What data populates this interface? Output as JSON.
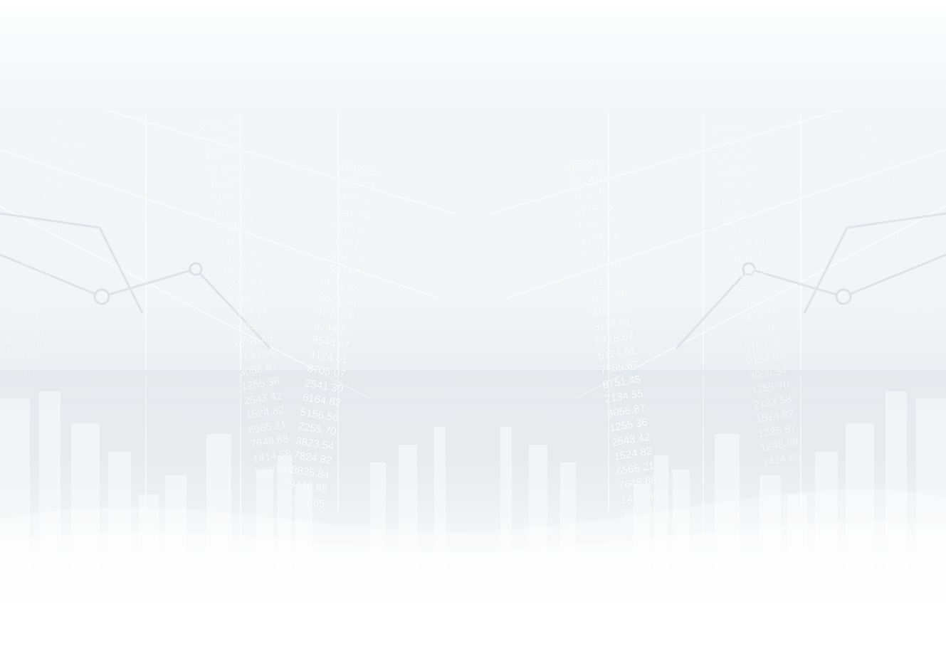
{
  "background": {
    "colors": {
      "top": "#ffffff",
      "mid": "#f2f4f6",
      "band": "#e9ecef",
      "bottom": "#ffffff",
      "numbers": "#ffffff"
    },
    "number_columns": [
      [
        "1522.52",
        "2154.54",
        "1552.22",
        "6364.13",
        "2254.41",
        "3124.87",
        "6128.87",
        "4141.46",
        "2121.35",
        "3123.43",
        "2218.87",
        "4152.29",
        "7824.61",
        "5124.87",
        "2134.87",
        "3056.58",
        "1524.82",
        "5405.87"
      ],
      [
        "8754.13",
        "1514.25",
        "1417.52",
        "3215.25",
        "1552.52",
        "5184.13",
        "8704.22",
        "5128.67",
        "7114.87",
        "9721.88",
        "5124.76",
        "3115.51",
        "8715.67",
        "5124.61",
        "7605.67",
        "8751.45",
        "2134.55",
        "3056.87",
        "1255.36",
        "2543.42",
        "1524.82",
        "6565.21",
        "7648.88",
        "1414.58",
        "5130.52"
      ],
      [
        "2543.15",
        "1561.21",
        "2427.52",
        "7545.24",
        "6542.52",
        "2124.13",
        "3684.21",
        "7524.67",
        "6824.87",
        "9621.46",
        "5724.76",
        "8744.82",
        "9548.87",
        "4124.61",
        "8705.07",
        "2541.30",
        "6164.82",
        "5156.56",
        "2255.70",
        "3823.54",
        "7824.82",
        "8835.84",
        "9446.88",
        "2864.65"
      ],
      [
        "8754.15",
        "1714.25",
        "1417.52",
        "3215.25",
        "1552.52",
        "5184.13",
        "8724.22",
        "5124.67",
        "7114.87",
        "9721.88",
        "3124.76",
        "3114.61",
        "8718.67",
        "5124.61",
        "7605.67",
        "8751.45",
        "2134.55",
        "3056.87",
        "1255.36",
        "2543.42",
        "1524.82",
        "6565.21",
        "7648.88",
        "1414.88",
        "2813.88"
      ],
      [
        "1233.15",
        "1564.24",
        "1527.57",
        "4215.24",
        "1552.52",
        "6784.13",
        "8754.21",
        "5124.67",
        "8724.87",
        "3121.46",
        "3164.55",
        "5724.51",
        "2418.87",
        "3124.61",
        "7605.05",
        "8151.56",
        "2134.87",
        "3056.54",
        "1255.70",
        "2123.58",
        "1524.82",
        "1225.87",
        "1248.88",
        "1414.65"
      ],
      [
        "1417.55",
        "1414.23",
        "1552.52",
        "6364.13",
        "2254.41",
        "3124.67",
        "2114.87",
        "8724.04",
        "1125.24",
        "3414.21",
        "2214.57",
        "2343.54",
        "2134.54",
        "1524.82",
        "6565.21"
      ]
    ]
  }
}
